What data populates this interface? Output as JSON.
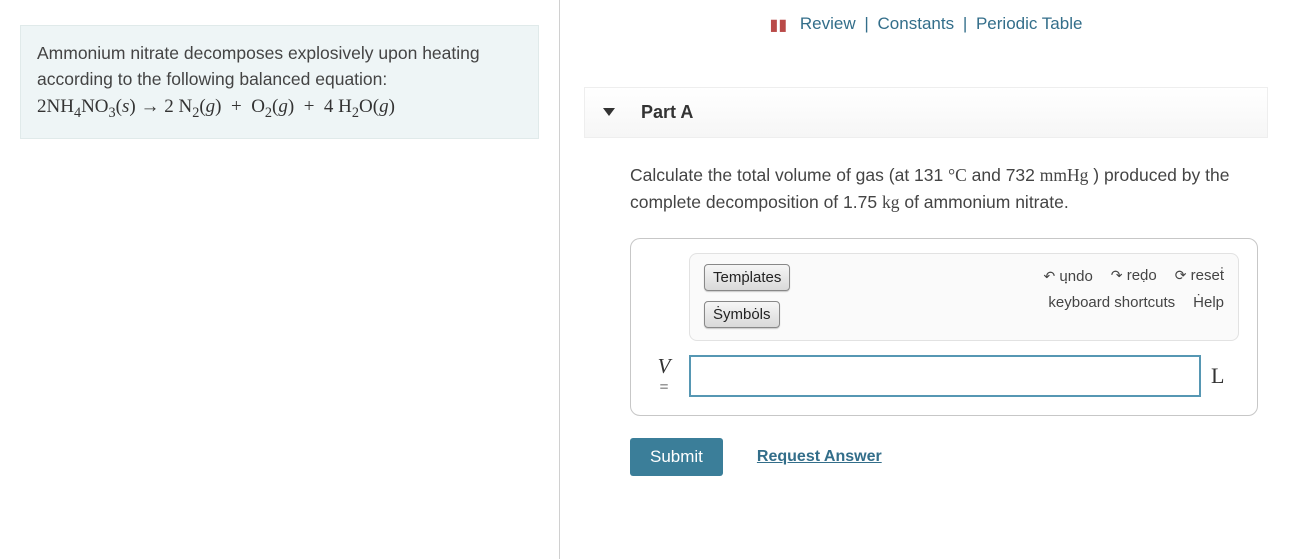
{
  "top_links": {
    "review": "Review",
    "constants": "Constants",
    "periodic": "Periodic Table"
  },
  "prompt": {
    "text_line1": "Ammonium nitrate decomposes explosively upon heating according to the following balanced equation:",
    "equation_html": "2NH<sub>4</sub>NO<sub>3</sub>(<i>s</i>) → 2 N<sub>2</sub>(<i>g</i>) &nbsp;+&nbsp; O<sub>2</sub>(<i>g</i>) &nbsp;+&nbsp; 4 H<sub>2</sub>O(<i>g</i>)"
  },
  "part": {
    "label": "Part A"
  },
  "question": {
    "html": "Calculate the total volume of gas (at 131 <span class='sci'>°C</span> and 732 <span class='sci'>mmHg</span> ) produced by the complete decomposition of 1.75 <span class='sci'>kg</span> of ammonium nitrate."
  },
  "toolbar": {
    "templates": "Temṗlates",
    "symbols": "Ṡymbȯls",
    "undo": "uฺndo",
    "redo": "reḍo",
    "reset": "reseṫ",
    "kbd": "keyboard shortcuts",
    "help": "Ḣelp"
  },
  "answer": {
    "variable": "V",
    "equals": "=",
    "value": "",
    "unit": "L"
  },
  "actions": {
    "submit": "Submit",
    "request": "Request Answer"
  }
}
